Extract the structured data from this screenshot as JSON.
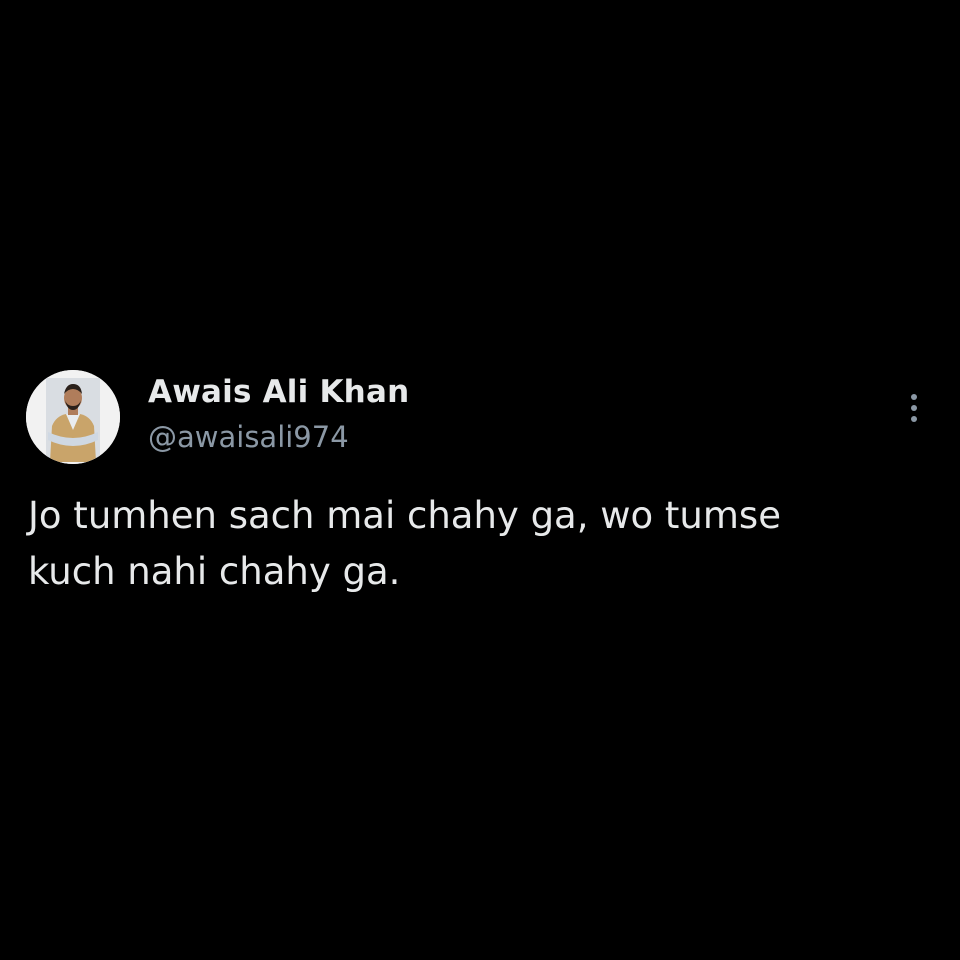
{
  "author": {
    "display_name": "Awais Ali Khan",
    "handle": "@awaisali974",
    "avatar_icon": "profile-photo"
  },
  "tweet": {
    "text": "Jo tumhen sach mai chahy ga, wo tumse\nkuch nahi chahy ga."
  },
  "actions": {
    "more_icon": "more-vertical-icon"
  },
  "colors": {
    "background": "#000000",
    "primary_text": "#e7e9ea",
    "secondary_text": "#8b98a5"
  }
}
